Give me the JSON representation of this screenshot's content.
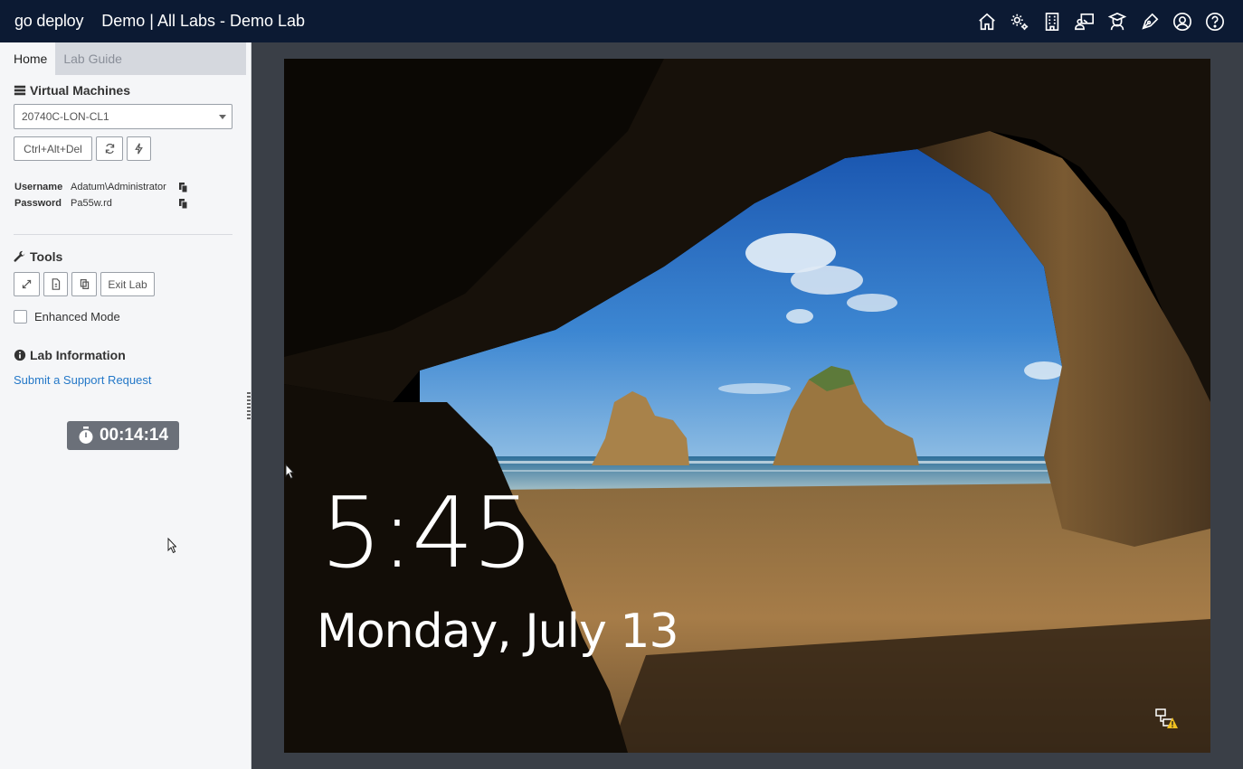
{
  "header": {
    "brand": "go deploy",
    "breadcrumb": "Demo | All Labs - Demo Lab",
    "icons": [
      "home-icon",
      "settings-icon",
      "building-icon",
      "instructor-icon",
      "graduate-icon",
      "pen-icon",
      "account-icon",
      "help-icon"
    ]
  },
  "sidebar": {
    "tabs": [
      {
        "label": "Home",
        "active": true
      },
      {
        "label": "Lab Guide",
        "active": false
      }
    ],
    "vm_section": {
      "title": "Virtual Machines",
      "selected_vm": "20740C-LON-CL1",
      "ctrl_alt_del_label": "Ctrl+Alt+Del"
    },
    "credentials": {
      "username_label": "Username",
      "username_value": "Adatum\\Administrator",
      "password_label": "Password",
      "password_value": "Pa55w.rd"
    },
    "tools": {
      "title": "Tools",
      "exit_label": "Exit Lab",
      "enhanced_mode_label": "Enhanced Mode",
      "enhanced_mode_checked": false
    },
    "lab_info": {
      "title": "Lab Information",
      "support_link": "Submit a Support Request"
    },
    "timer": "00:14:14"
  },
  "vm_screen": {
    "time": "5:45",
    "date": "Monday, July 13"
  },
  "colors": {
    "topbar": "#0c1a33",
    "link": "#2478c8",
    "timer_bg": "#6b7079",
    "workspace_bg": "#3a3f47"
  }
}
